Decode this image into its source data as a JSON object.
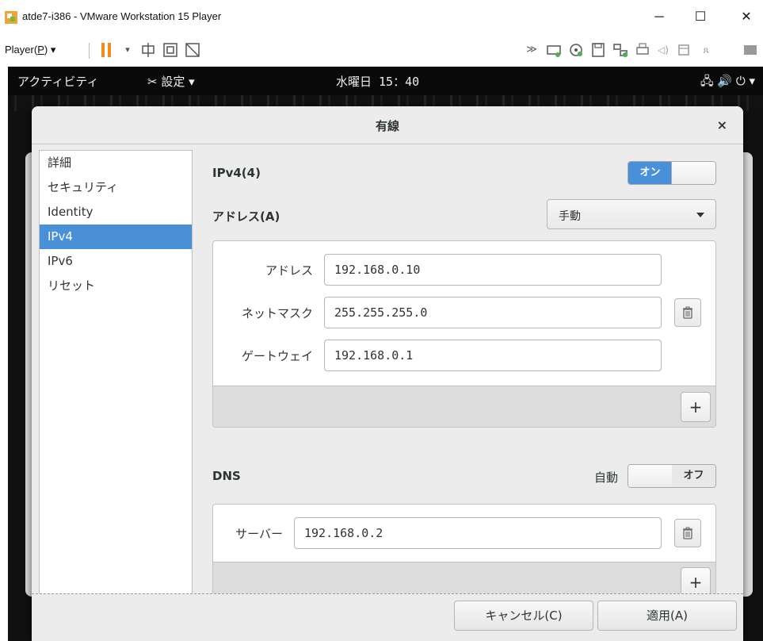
{
  "window": {
    "title": "atde7-i386 - VMware Workstation 15 Player",
    "minimize": "─",
    "maximize": "☐",
    "close": "✕"
  },
  "toolbar": {
    "player_menu_prefix": "Player(",
    "player_menu_key": "P",
    "player_menu_suffix": ")",
    "accent": "#f28a1e"
  },
  "gnome": {
    "activities": "アクティビティ",
    "settings_menu": "設定",
    "clock": "水曜日 15：40"
  },
  "dialog": {
    "title": "有線",
    "close": "×"
  },
  "sidebar": {
    "items": [
      {
        "label": "詳細"
      },
      {
        "label": "セキュリティ"
      },
      {
        "label": "Identity"
      },
      {
        "label": "IPv4"
      },
      {
        "label": "IPv6"
      },
      {
        "label": "リセット"
      }
    ],
    "active_color": "#4a90d9"
  },
  "ipv4": {
    "title": "IPv4(4)",
    "toggle_on": "オン",
    "address_section": "アドレス(A)",
    "method": "手動",
    "address_label": "アドレス",
    "address_value": "192.168.0.10",
    "netmask_label": "ネットマスク",
    "netmask_value": "255.255.255.0",
    "gateway_label": "ゲートウェイ",
    "gateway_value": "192.168.0.1",
    "add_label": "+"
  },
  "dns": {
    "title": "DNS",
    "auto_label": "自動",
    "toggle_off": "オフ",
    "server_label": "サーバー",
    "server_value": "192.168.0.2",
    "add_label": "+"
  },
  "buttons": {
    "cancel": "キャンセル(C)",
    "apply": "適用(A)"
  }
}
